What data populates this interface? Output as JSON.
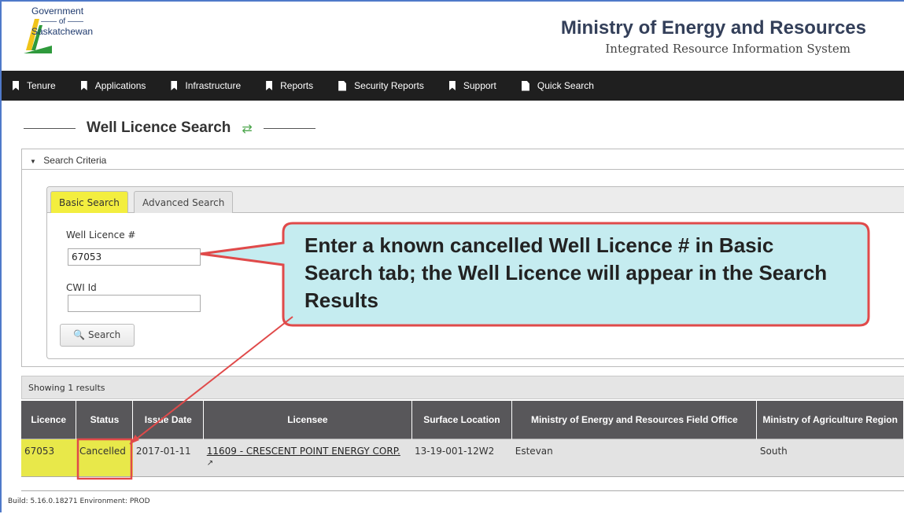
{
  "header": {
    "logo_line1": "Government",
    "logo_line2": "of",
    "logo_line3": "Saskatchewan",
    "ministry_title": "Ministry of Energy and Resources",
    "ministry_subtitle": "Integrated Resource Information System"
  },
  "nav": {
    "items": [
      {
        "label": "Tenure",
        "icon": "bookmark-icon"
      },
      {
        "label": "Applications",
        "icon": "bookmark-icon"
      },
      {
        "label": "Infrastructure",
        "icon": "bookmark-icon"
      },
      {
        "label": "Reports",
        "icon": "bookmark-icon"
      },
      {
        "label": "Security Reports",
        "icon": "document-icon"
      },
      {
        "label": "Support",
        "icon": "bookmark-icon"
      },
      {
        "label": "Quick Search",
        "icon": "document-icon"
      }
    ]
  },
  "page": {
    "title": "Well Licence Search",
    "refresh_icon": "refresh-icon"
  },
  "criteria": {
    "header": "Search Criteria",
    "tabs": [
      "Basic Search",
      "Advanced Search"
    ],
    "active_tab": "Basic Search",
    "well_licence_label": "Well Licence #",
    "well_licence_value": "67053",
    "cwi_label": "CWI Id",
    "cwi_value": "",
    "search_button": "Search"
  },
  "results": {
    "summary": "Showing 1 results",
    "columns": [
      "Licence",
      "Status",
      "Issue Date",
      "Licensee",
      "Surface Location",
      "Ministry of Energy and Resources Field Office",
      "Ministry of Agriculture Region"
    ],
    "rows": [
      {
        "licence": "67053",
        "status": "Cancelled",
        "issue_date": "2017-01-11",
        "licensee": "11609 - CRESCENT POINT ENERGY CORP.",
        "surface_location": "13-19-001-12W2",
        "field_office": "Estevan",
        "region": "South"
      }
    ]
  },
  "footer": {
    "build": "Build: 5.16.0.18271 Environment: PROD"
  },
  "annotation": {
    "callout_text": "Enter a known cancelled Well Licence # in Basic Search tab; the Well Licence will appear in the Search Results"
  },
  "colors": {
    "nav_bg": "#1f1f1f",
    "highlight_yellow": "#e8e84a",
    "callout_fill": "#c5ecf0",
    "callout_border": "#e04a4a",
    "header_title": "#333f59"
  }
}
